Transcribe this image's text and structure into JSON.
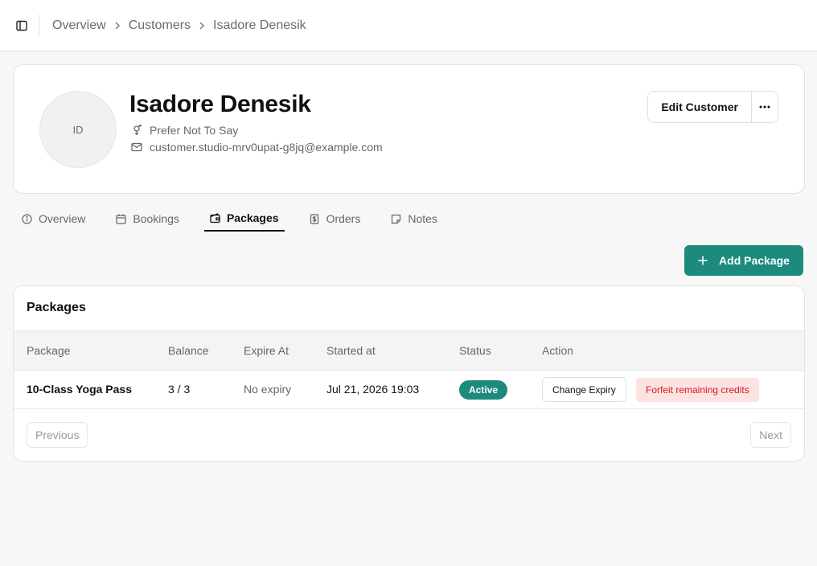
{
  "breadcrumb": {
    "items": [
      "Overview",
      "Customers",
      "Isadore Denesik"
    ]
  },
  "customer": {
    "initials": "ID",
    "name": "Isadore Denesik",
    "gender": "Prefer Not To Say",
    "email": "customer.studio-mrv0upat-g8jq@example.com"
  },
  "actions": {
    "edit_label": "Edit Customer"
  },
  "tabs": [
    {
      "label": "Overview",
      "icon": "info-icon",
      "active": false
    },
    {
      "label": "Bookings",
      "icon": "calendar-icon",
      "active": false
    },
    {
      "label": "Packages",
      "icon": "wallet-icon",
      "active": true
    },
    {
      "label": "Orders",
      "icon": "receipt-icon",
      "active": false
    },
    {
      "label": "Notes",
      "icon": "sticky-note-icon",
      "active": false
    }
  ],
  "add_package_label": "Add Package",
  "packages": {
    "title": "Packages",
    "columns": [
      "Package",
      "Balance",
      "Expire At",
      "Started at",
      "Status",
      "Action"
    ],
    "rows": [
      {
        "package": "10-Class Yoga Pass",
        "balance": "3 / 3",
        "expire_at": "No expiry",
        "started_at": "Jul 21, 2026 19:03",
        "status": "Active",
        "change_expiry_label": "Change Expiry",
        "forfeit_label": "Forfeit remaining credits"
      }
    ],
    "previous_label": "Previous",
    "next_label": "Next"
  },
  "colors": {
    "accent": "#1d8a7e",
    "danger_text": "#d21c1c",
    "danger_bg": "#fde2e2"
  }
}
